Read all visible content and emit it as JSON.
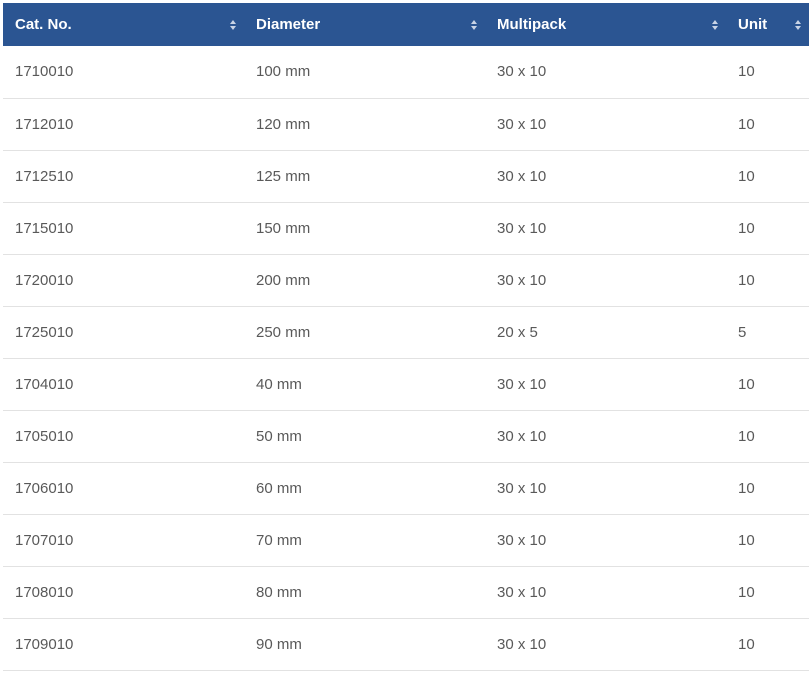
{
  "table": {
    "columns": [
      "Cat. No.",
      "Diameter",
      "Multipack",
      "Unit"
    ],
    "header_color": "#2b5592",
    "rows": [
      [
        "1710010",
        "100 mm",
        "30 x 10",
        "10"
      ],
      [
        "1712010",
        "120 mm",
        "30 x 10",
        "10"
      ],
      [
        "1712510",
        "125 mm",
        "30 x 10",
        "10"
      ],
      [
        "1715010",
        "150 mm",
        "30 x 10",
        "10"
      ],
      [
        "1720010",
        "200 mm",
        "30 x 10",
        "10"
      ],
      [
        "1725010",
        "250 mm",
        "20 x 5",
        "5"
      ],
      [
        "1704010",
        "40 mm",
        "30 x 10",
        "10"
      ],
      [
        "1705010",
        "50 mm",
        "30 x 10",
        "10"
      ],
      [
        "1706010",
        "60 mm",
        "30 x 10",
        "10"
      ],
      [
        "1707010",
        "70 mm",
        "30 x 10",
        "10"
      ],
      [
        "1708010",
        "80 mm",
        "30 x 10",
        "10"
      ],
      [
        "1709010",
        "90 mm",
        "30 x 10",
        "10"
      ]
    ]
  }
}
